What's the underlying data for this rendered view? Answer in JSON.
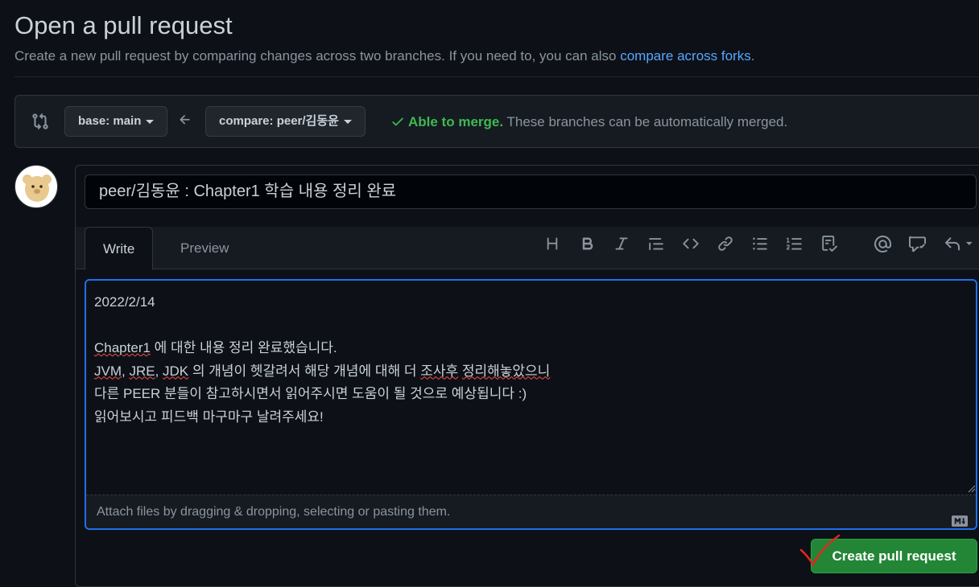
{
  "header": {
    "title": "Open a pull request",
    "subtitle_prefix": "Create a new pull request by comparing changes across two branches. If you need to, you can also ",
    "subtitle_link": "compare across forks",
    "subtitle_suffix": "."
  },
  "compare": {
    "base_label": "base: main",
    "compare_label": "compare: peer/김동윤",
    "status_ok": "Able to merge.",
    "status_text": " These branches can be automatically merged."
  },
  "pr": {
    "title_value": "peer/김동윤 : Chapter1 학습 내용 정리 완료",
    "tabs": [
      "Write",
      "Preview"
    ],
    "body_date": "2022/2/14",
    "body_line1_a": "Chapter1",
    "body_line1_b": " 에 대한 내용 정리 완료했습니다.",
    "body_line2_a": "JVM",
    "body_line2_b": ", ",
    "body_line2_c": "JRE",
    "body_line2_d": ", ",
    "body_line2_e": "JDK",
    "body_line2_f": " 의 개념이 헷갈려서 해당 개념에 대해 더 ",
    "body_line2_g": "조사후",
    "body_line2_h": " ",
    "body_line2_i": "정리해놓았으니",
    "body_line3": "다른 PEER 분들이 참고하시면서 읽어주시면 도움이 될 것으로 예상됩니다 :)",
    "body_line4": "읽어보시고 피드백 마구마구 날려주세요!",
    "attach_text": "Attach files by dragging & dropping, selecting or pasting them.",
    "submit_label": "Create pull request"
  },
  "toolbar_icons": [
    "heading-icon",
    "bold-icon",
    "italic-icon",
    "quote-icon",
    "code-icon",
    "link-icon",
    "bulleted-list-icon",
    "numbered-list-icon",
    "task-list-icon",
    "mention-icon",
    "reference-icon",
    "reply-icon"
  ],
  "colors": {
    "accent": "#1f6feb",
    "success": "#3fb950",
    "button": "#238636",
    "link": "#58a6ff",
    "bg": "#0d1117"
  }
}
